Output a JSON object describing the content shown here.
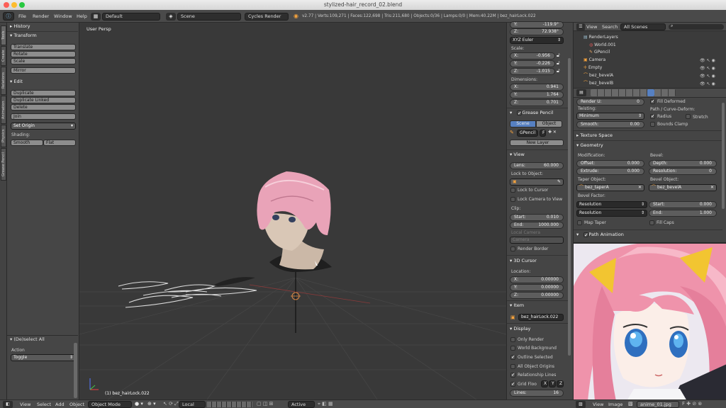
{
  "window_title": "stylized-hair_record_02.blend",
  "top_menu": [
    "File",
    "Render",
    "Window",
    "Help"
  ],
  "layout": "Default",
  "scene": "Scene",
  "render_engine": "Cycles Render",
  "stats": "v2.77 | Verts:109,271 | Faces:122,698 | Tris:211,680 | Objects:0/36 | Lamps:0/0 | Mem:40.22M | bez_hairLock.022",
  "left_tabs": [
    "Tools",
    "Create",
    "Relations",
    "Animation",
    "Physics",
    "Grease Pencil"
  ],
  "tool_panel": {
    "history": "History",
    "transform": "Transform",
    "transform_btns": [
      "Translate",
      "Rotate",
      "Scale",
      "Mirror"
    ],
    "edit": "Edit",
    "edit_btns": [
      "Duplicate",
      "Duplicate Linked",
      "Delete",
      "Join"
    ],
    "set_origin": "Set Origin",
    "shading": "Shading:",
    "smooth": "Smooth",
    "flat": "Flat",
    "operator": "(De)select All",
    "action_label": "Action",
    "action_value": "Toggle"
  },
  "viewport": {
    "persp": "User Persp",
    "object_label": "(1) bez_hairLock.022"
  },
  "bottom_bar": {
    "menus": [
      "View",
      "Select",
      "Add",
      "Object"
    ],
    "mode": "Object Mode",
    "pivot": "Local",
    "active": "Active"
  },
  "n_panel": {
    "rot_y": "Y:",
    "rot_y_val": "-119.9°",
    "rot_z": "Z:",
    "rot_z_val": "72.938°",
    "euler": "XYZ Euler",
    "scale_label": "Scale:",
    "scale": [
      {
        "a": "X:",
        "v": "-0.956"
      },
      {
        "a": "Y:",
        "v": "-0.226"
      },
      {
        "a": "Z:",
        "v": "-1.015"
      }
    ],
    "dims_label": "Dimensions:",
    "dims": [
      {
        "a": "X:",
        "v": "0.941"
      },
      {
        "a": "Y:",
        "v": "1.764"
      },
      {
        "a": "Z:",
        "v": "0.701"
      }
    ],
    "gp_header": "Grease Pencil",
    "gp_scene": "Scene",
    "gp_object": "Object",
    "gp_name": "GPencil",
    "gp_f": "F",
    "new_layer": "New Layer",
    "view_header": "View",
    "lens_label": "Lens:",
    "lens_val": "60.000",
    "lock_to_object": "Lock to Object:",
    "lock_to_cursor": "Lock to Cursor",
    "lock_cam": "Lock Camera to View",
    "clip_label": "Clip:",
    "clip_start_l": "Start:",
    "clip_start": "0.010",
    "clip_end_l": "End:",
    "clip_end": "1000.000",
    "local_camera": "Local Camera",
    "camera": "Camera",
    "render_border": "Render Border",
    "cursor_header": "3D Cursor",
    "location_label": "Location:",
    "loc": [
      {
        "a": "X:",
        "v": "0.00000"
      },
      {
        "a": "Y:",
        "v": "0.00000"
      },
      {
        "a": "Z:",
        "v": "0.00000"
      }
    ],
    "item_header": "Item",
    "item_name": "bez_hairLock.022",
    "display_header": "Display",
    "display": [
      "Only Render",
      "World Background",
      "Outline Selected",
      "All Object Origins",
      "Relationship Lines"
    ],
    "grid_floor": "Grid Floo",
    "axes": [
      "X",
      "Y",
      "Z"
    ],
    "lines_l": "Lines:",
    "lines_v": "16"
  },
  "outliner": {
    "menus": [
      "View",
      "Search"
    ],
    "filter": "All Scenes",
    "items": [
      "RenderLayers",
      "World.001",
      "GPencil",
      "Camera",
      "Empty",
      "bez_bevelA",
      "bez_bevelB"
    ]
  },
  "props": {
    "render_u_l": "Render U:",
    "render_u_v": "0",
    "fill_deformed": "Fill Deformed",
    "twisting": "Twisting:",
    "twist_mode": "Minimum",
    "smooth_l": "Smooth:",
    "smooth_v": "0.00",
    "path_deform": "Path / Curve-Deform:",
    "radius": "Radius",
    "stretch": "Stretch",
    "bounds_clamp": "Bounds Clamp",
    "texture_space": "Texture Space",
    "geometry": "Geometry",
    "modification": "Modification:",
    "bevel": "Bevel:",
    "offset_l": "Offset:",
    "offset_v": "0.000",
    "depth_l": "Depth:",
    "depth_v": "0.000",
    "extrude_l": "Extrude:",
    "extrude_v": "0.000",
    "resolution_l": "Resolution:",
    "resolution_v": "0",
    "taper_object": "Taper Object:",
    "bevel_object": "Bevel Object:",
    "taper_name": "bez_taperA",
    "bevel_name": "bez_bevelA",
    "bevel_factor": "Bevel Factor:",
    "res1": "Resolution",
    "res2": "Resolution",
    "start_l": "Start:",
    "start_v": "0.000",
    "end_l": "End:",
    "end_v": "1.000",
    "map_taper": "Map Taper",
    "fill_caps": "Fill Caps",
    "path_anim": "Path Animation"
  },
  "image_editor": {
    "menus": [
      "View",
      "Image"
    ],
    "image_name": "anime_01.jpg"
  }
}
